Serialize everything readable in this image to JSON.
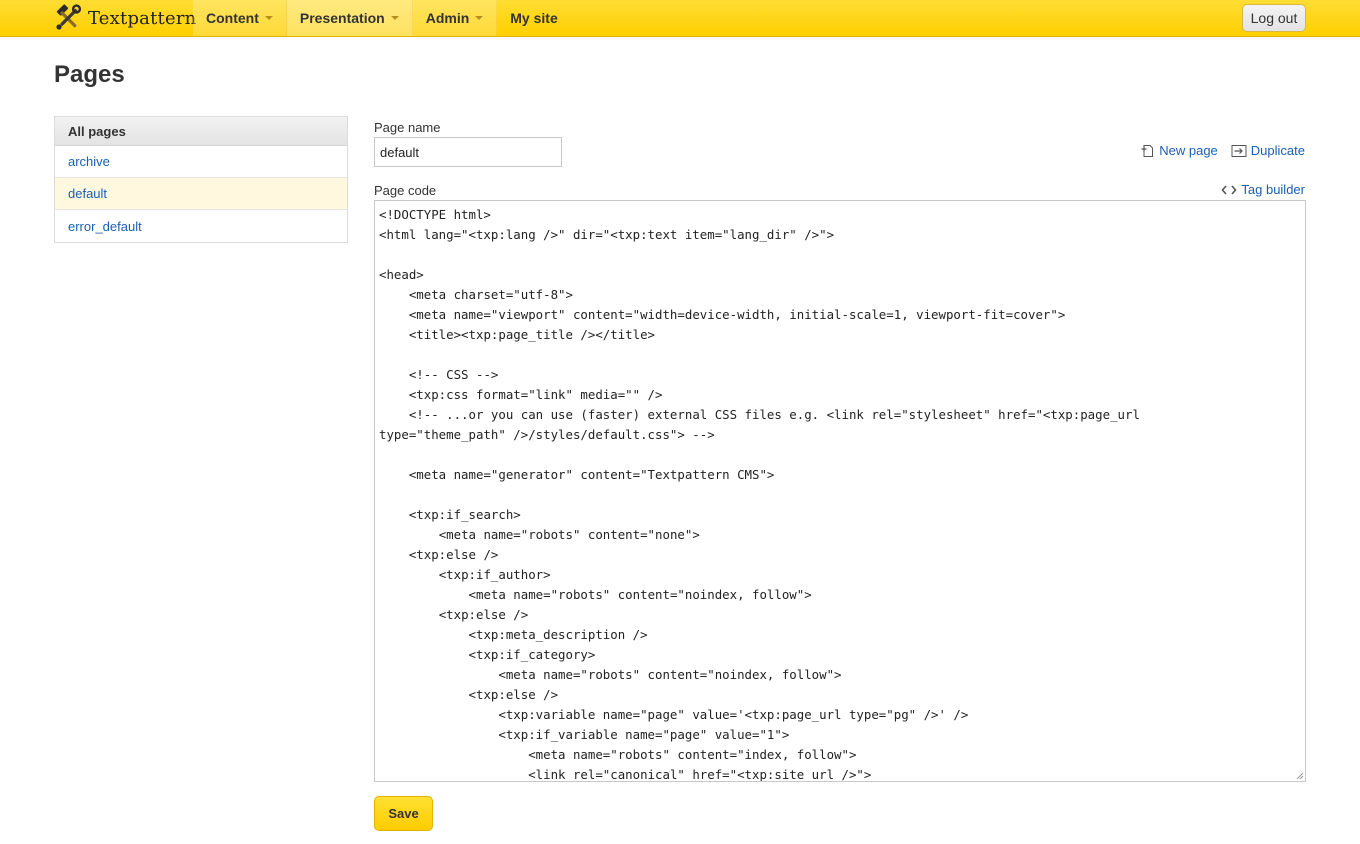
{
  "app": {
    "brand": "Textpattern",
    "logo_icon": "crossed-tools-icon"
  },
  "nav": {
    "items": [
      {
        "label": "Content"
      },
      {
        "label": "Presentation"
      },
      {
        "label": "Admin"
      },
      {
        "label": "My site"
      }
    ],
    "logout_label": "Log out"
  },
  "page": {
    "title": "Pages"
  },
  "sidebar": {
    "heading": "All pages",
    "items": [
      {
        "label": "archive"
      },
      {
        "label": "default"
      },
      {
        "label": "error_default"
      }
    ]
  },
  "form": {
    "name_label": "Page name",
    "name_value": "default",
    "new_page_label": "New page",
    "duplicate_label": "Duplicate",
    "code_label": "Page code",
    "tag_builder_label": "Tag builder",
    "code_value": "<!DOCTYPE html>\n<html lang=\"<txp:lang />\" dir=\"<txp:text item=\"lang_dir\" />\">\n\n<head>\n    <meta charset=\"utf-8\">\n    <meta name=\"viewport\" content=\"width=device-width, initial-scale=1, viewport-fit=cover\">\n    <title><txp:page_title /></title>\n\n    <!-- CSS -->\n    <txp:css format=\"link\" media=\"\" />\n    <!-- ...or you can use (faster) external CSS files e.g. <link rel=\"stylesheet\" href=\"<txp:page_url\ntype=\"theme_path\" />/styles/default.css\"> -->\n\n    <meta name=\"generator\" content=\"Textpattern CMS\">\n\n    <txp:if_search>\n        <meta name=\"robots\" content=\"none\">\n    <txp:else />\n        <txp:if_author>\n            <meta name=\"robots\" content=\"noindex, follow\">\n        <txp:else />\n            <txp:meta_description />\n            <txp:if_category>\n                <meta name=\"robots\" content=\"noindex, follow\">\n            <txp:else />\n                <txp:variable name=\"page\" value='<txp:page_url type=\"pg\" />' />\n                <txp:if_variable name=\"page\" value=\"1\">\n                    <meta name=\"robots\" content=\"index, follow\">\n                    <link rel=\"canonical\" href=\"<txp:site_url />\">",
    "save_label": "Save"
  }
}
